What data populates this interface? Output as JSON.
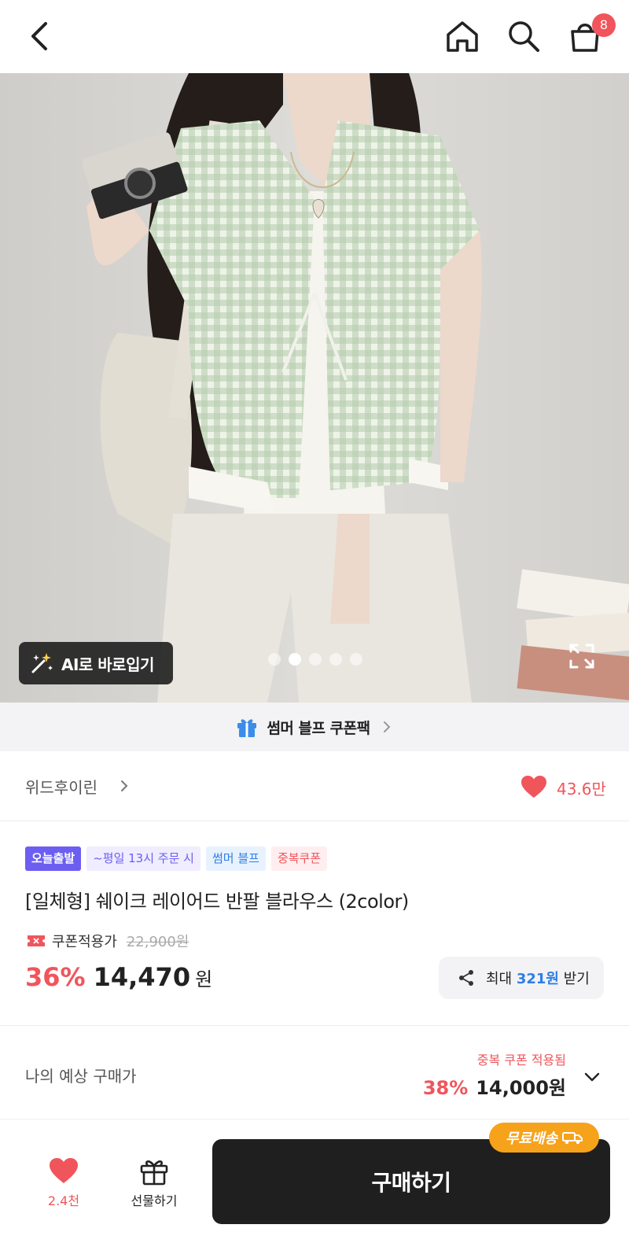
{
  "header": {
    "cart_badge": "8"
  },
  "hero": {
    "ai_button": "AI로 바로입기",
    "dots_total": 5,
    "dots_active": 2
  },
  "coupon_bar": {
    "label": "썸머 블프 쿠폰팩"
  },
  "brand": {
    "name": "위드후이린",
    "like_count": "43.6만"
  },
  "tags": [
    "오늘출발",
    "~평일 13시 주문 시",
    "썸머 블프",
    "중복쿠폰"
  ],
  "product": {
    "title": "[일체형] 쉐이크 레이어드 반팔 블라우스 (2color)",
    "coupon_label": "쿠폰적용가",
    "original_price": "22,900원",
    "discount": "36%",
    "price": "14,470",
    "currency": "원"
  },
  "share": {
    "prefix": "최대 ",
    "amount": "321원",
    "suffix": " 받기"
  },
  "expected": {
    "label": "나의 예상 구매가",
    "dup_coupon": "중복 쿠폰 적용됨",
    "discount": "38%",
    "price": "14,000원"
  },
  "bottom": {
    "like_count": "2.4천",
    "gift_label": "선물하기",
    "buy_label": "구매하기",
    "free_shipping": "무료배송"
  },
  "colors": {
    "accent_red": "#f0555b",
    "accent_purple": "#6b5ef0",
    "accent_blue": "#2f7ee6",
    "badge_orange": "#f7a21b",
    "buy_button": "#1f1f1f"
  }
}
